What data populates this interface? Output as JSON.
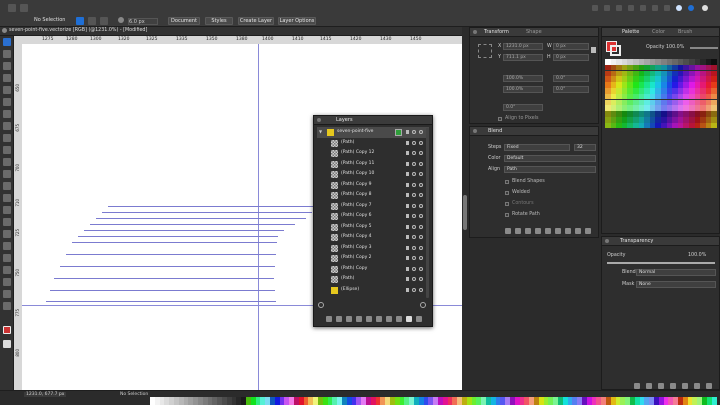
{
  "toolbar": {
    "selection": "No Selection",
    "stroke_value": "6.0 px",
    "document_label": "Document",
    "styles_label": "Styles",
    "create_layer_label": "Create Layer",
    "layer_options_label": "Layer Options"
  },
  "doc_tab": {
    "title": "seven-point-five.vectorize [RGB] (@1231.0%) - [Modified]"
  },
  "ruler_h": {
    "ticks": [
      "1275",
      "1280",
      "1300",
      "1320",
      "1325",
      "1335",
      "1350",
      "1380",
      "1400",
      "1410",
      "1415",
      "1420",
      "1430",
      "1450"
    ]
  },
  "ruler_v": {
    "ticks": [
      "650",
      "675",
      "700",
      "710",
      "725",
      "750",
      "775",
      "800"
    ]
  },
  "layers_panel": {
    "title": "Layers",
    "rows": [
      {
        "name": "seven-point-five",
        "thumb": "yellow",
        "selected": true,
        "parent": true
      },
      {
        "name": "(Path)"
      },
      {
        "name": "(Path) Copy 12"
      },
      {
        "name": "(Path) Copy 11"
      },
      {
        "name": "(Path) Copy 10"
      },
      {
        "name": "(Path) Copy 9"
      },
      {
        "name": "(Path) Copy 8"
      },
      {
        "name": "(Path) Copy 7"
      },
      {
        "name": "(Path) Copy 6"
      },
      {
        "name": "(Path) Copy 5"
      },
      {
        "name": "(Path) Copy 4"
      },
      {
        "name": "(Path) Copy 3"
      },
      {
        "name": "(Path) Copy 2"
      },
      {
        "name": "(Path) Copy"
      },
      {
        "name": "(Path)"
      },
      {
        "name": "(Ellipse)",
        "thumb": "yellow"
      }
    ]
  },
  "transform_panel": {
    "tab_transform": "Transform",
    "tab_shape": "Shape",
    "x": "1231.0 px",
    "y": "711.1 px",
    "w": "0 px",
    "h": "0 px",
    "sx": "100.0%",
    "sy": "100.0%",
    "r": "0.0°",
    "s": "0.0°",
    "shear": "0.0°",
    "align_label": "Align to Pixels"
  },
  "blend_panel": {
    "title": "Blend",
    "steps_label": "Steps",
    "steps_mode": "Fixed",
    "steps_value": "32",
    "color_label": "Color",
    "color_value": "Default",
    "align_label": "Align",
    "align_value": "Path",
    "opts": [
      "Blend Shapes",
      "Welded",
      "Contours",
      "Rotate Path"
    ]
  },
  "palette_panel": {
    "tab_palette": "Palette",
    "tab_color": "Color",
    "tab_brush": "Brush",
    "opacity_label": "Opacity",
    "opacity_value": "100.0%"
  },
  "transparency_panel": {
    "title": "Transparency",
    "opacity_label": "Opacity",
    "opacity_value": "100.0%",
    "blend_label": "Blend",
    "blend_value": "Normal",
    "mask_label": "Mask",
    "mask_value": "None"
  },
  "status": {
    "coords": "1231.0, 677.7 px",
    "zoom": "...",
    "selection": "No Selection"
  },
  "colors": {
    "accent": "#1f6fd6",
    "guide": "#8a8ad8",
    "path": "#7b7bd0",
    "ellipse_yellow": "#e6c81e"
  }
}
